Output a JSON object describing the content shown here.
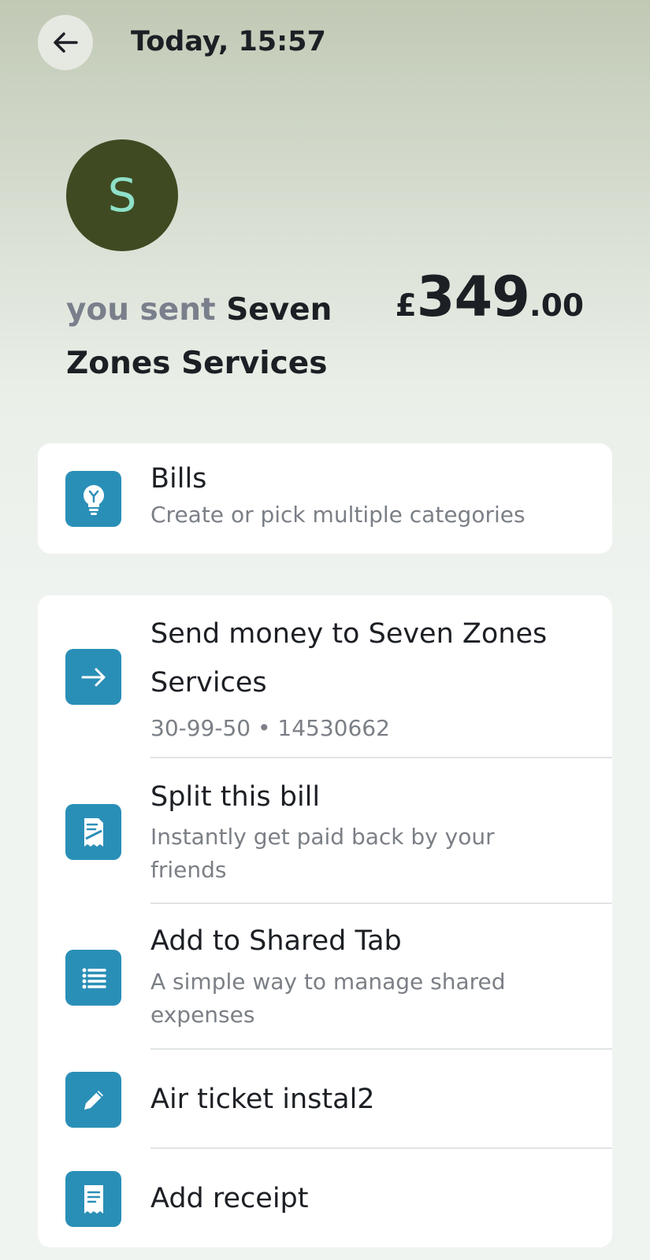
{
  "header": {
    "time": "Today, 15:57",
    "back_icon": "arrow-left-icon"
  },
  "payee": {
    "avatar_letter": "S",
    "sent_prefix": "you sent",
    "name": "Seven Zones Services",
    "amount_currency": "£",
    "amount_major": "349",
    "amount_minor": ".00"
  },
  "category": {
    "title": "Bills",
    "subtitle": "Create or pick multiple categories",
    "icon": "lightbulb-icon"
  },
  "actions": [
    {
      "title": "Send money to Seven Zones Services",
      "subtitle": "30-99-50 • 14530662",
      "icon": "arrow-right-icon"
    },
    {
      "title": "Split this bill",
      "subtitle": "Instantly get paid back by your friends",
      "icon": "split-receipt-icon"
    },
    {
      "title": "Add to Shared Tab",
      "subtitle": "A simple way to manage shared expenses",
      "icon": "list-icon"
    },
    {
      "title": "Air ticket instal2",
      "icon": "pencil-icon"
    },
    {
      "title": "Add receipt",
      "icon": "receipt-icon"
    }
  ],
  "colors": {
    "accent": "#2a8fb7",
    "avatar_bg": "#3f4a22",
    "avatar_text": "#8fe1c9"
  }
}
